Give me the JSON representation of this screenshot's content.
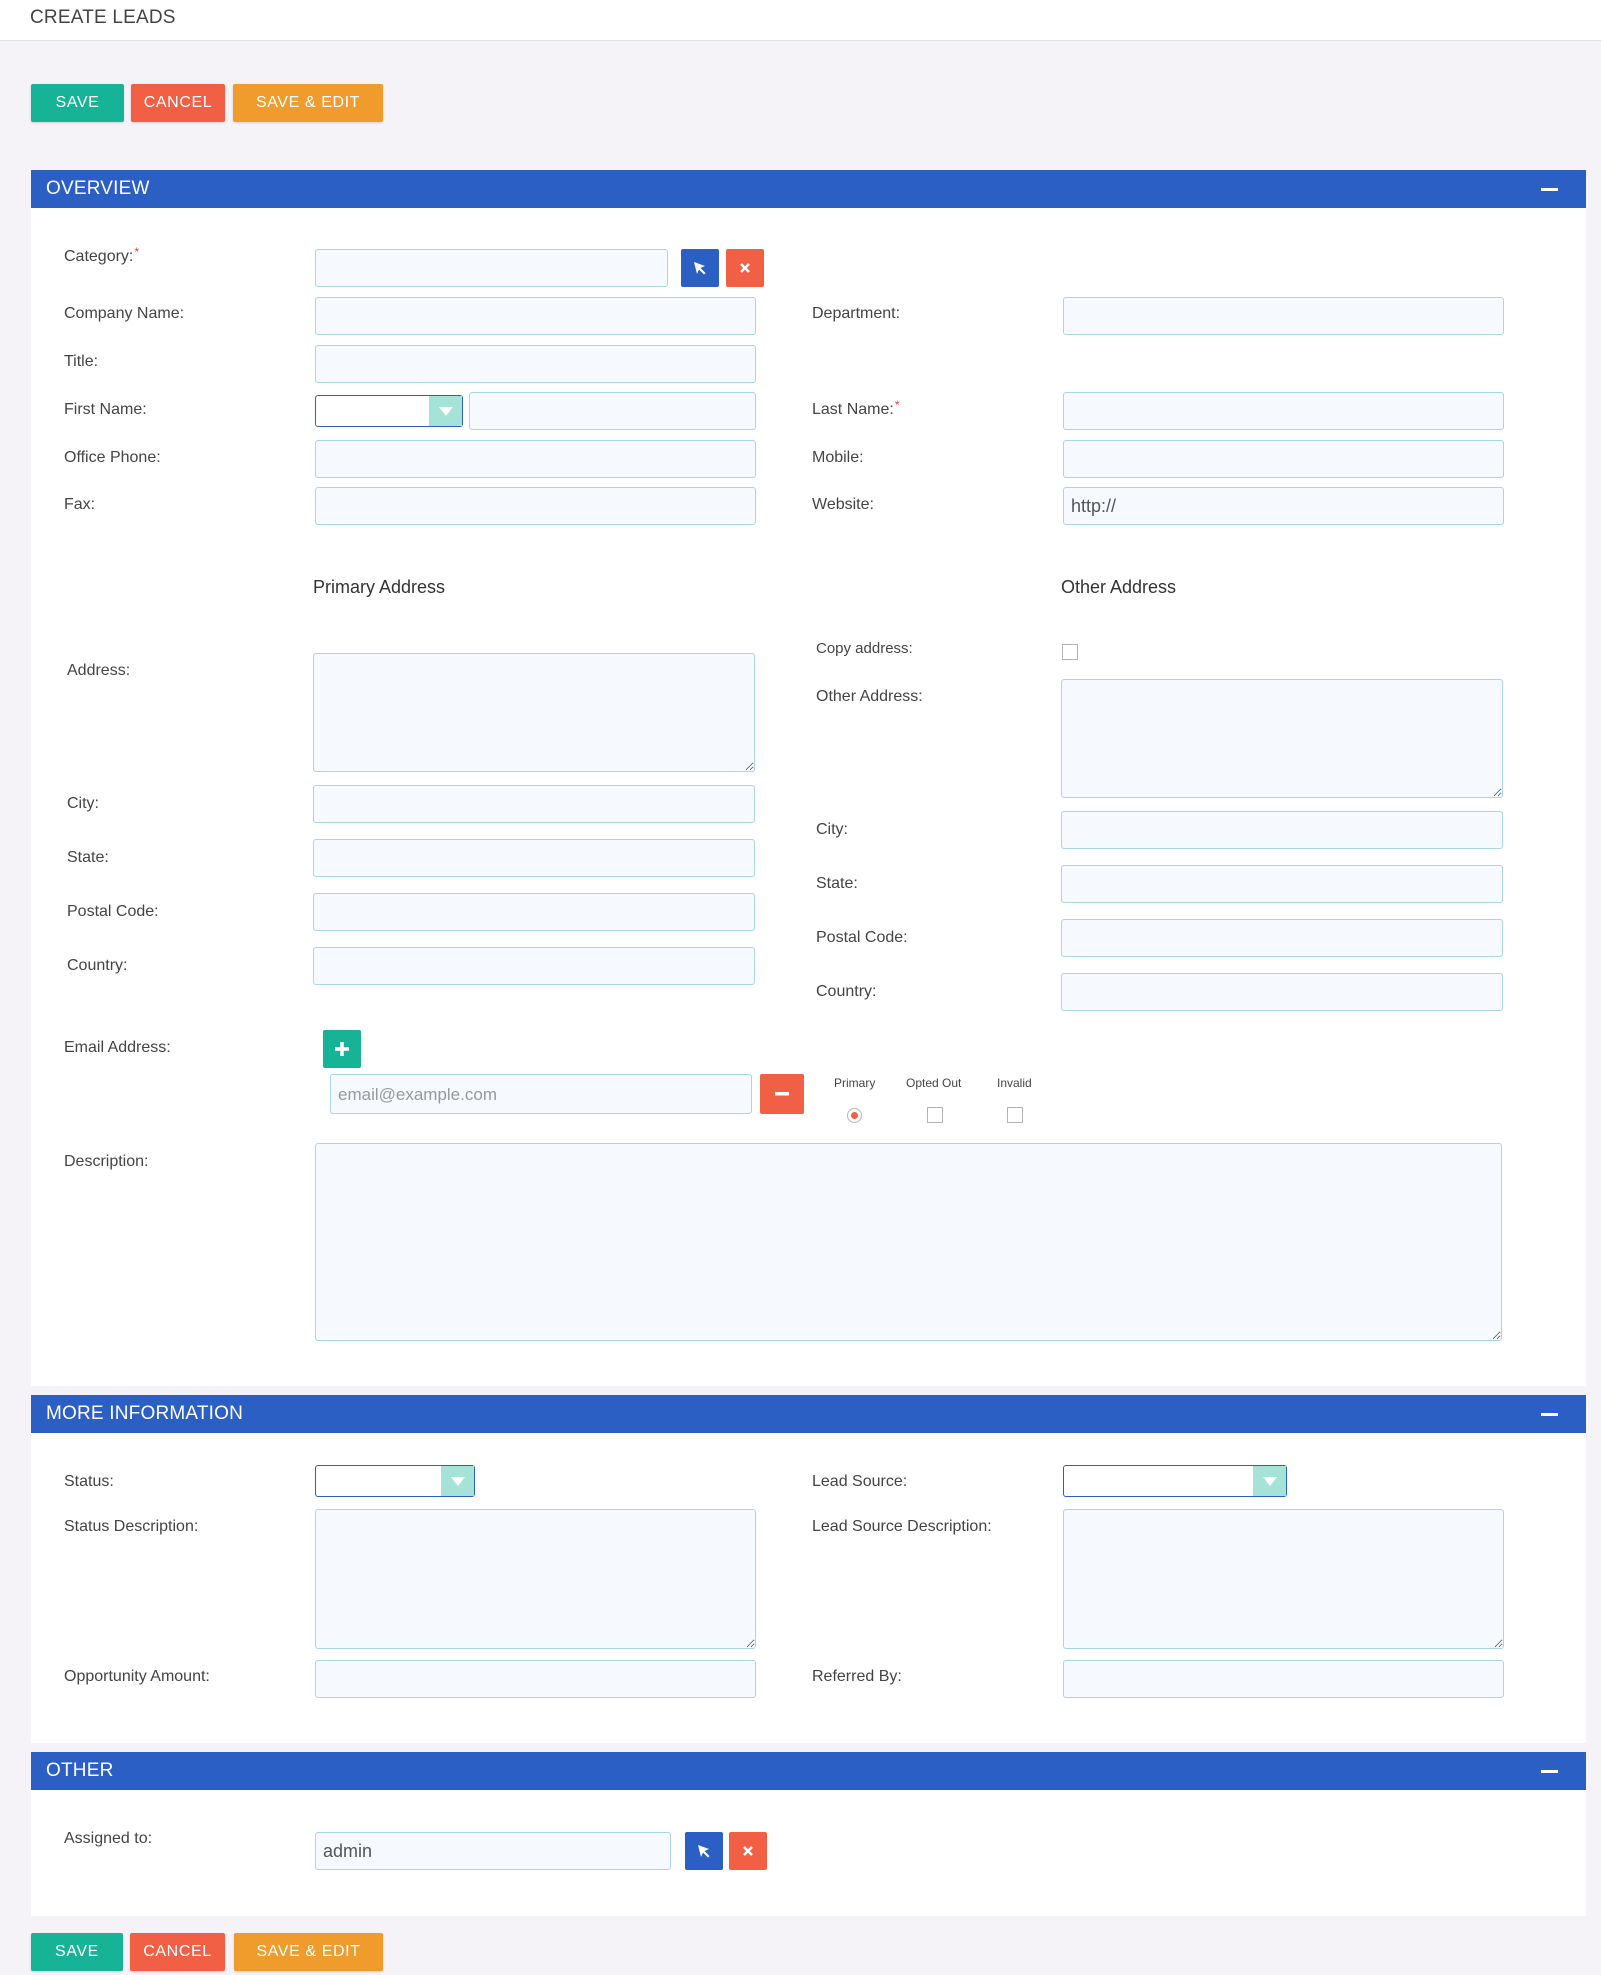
{
  "page": {
    "title": "CREATE LEADS"
  },
  "actions": {
    "save": "SAVE",
    "cancel": "CANCEL",
    "save_edit": "SAVE & EDIT"
  },
  "overview": {
    "title": "OVERVIEW",
    "category_label": "Category:",
    "company_name_label": "Company Name:",
    "department_label": "Department:",
    "title_label": "Title:",
    "first_name_label": "First Name:",
    "last_name_label": "Last Name:",
    "office_phone_label": "Office Phone:",
    "mobile_label": "Mobile:",
    "fax_label": "Fax:",
    "website_label": "Website:",
    "website_value": "http://",
    "primary_address_heading": "Primary Address",
    "other_address_heading": "Other Address",
    "address_label": "Address:",
    "copy_address_label": "Copy address:",
    "other_address_label": "Other Address:",
    "city_label": "City:",
    "state_label": "State:",
    "postal_code_label": "Postal Code:",
    "country_label": "Country:",
    "email_label": "Email Address:",
    "email_placeholder": "email@example.com",
    "email_flags": {
      "primary": "Primary",
      "opted_out": "Opted Out",
      "invalid": "Invalid"
    },
    "description_label": "Description:",
    "required_mark": "*"
  },
  "more_info": {
    "title": "MORE INFORMATION",
    "status_label": "Status:",
    "lead_source_label": "Lead Source:",
    "status_description_label": "Status Description:",
    "lead_source_description_label": "Lead Source Description:",
    "opportunity_amount_label": "Opportunity Amount:",
    "referred_by_label": "Referred By:"
  },
  "other": {
    "title": "OTHER",
    "assigned_to_label": "Assigned to:",
    "assigned_to_value": "admin"
  },
  "colors": {
    "primary_blue": "#2b5fc4",
    "save_green": "#17b396",
    "cancel_red": "#f15f45",
    "save_edit_orange": "#f09c2c",
    "input_bg": "#f6f9fd",
    "input_border": "#a9d4ec"
  },
  "icons": {
    "select": "cursor-arrow-icon",
    "clear": "close-icon",
    "add": "plus-icon",
    "remove": "minus-icon",
    "collapse": "minus-icon",
    "dropdown": "chevron-down-icon"
  }
}
